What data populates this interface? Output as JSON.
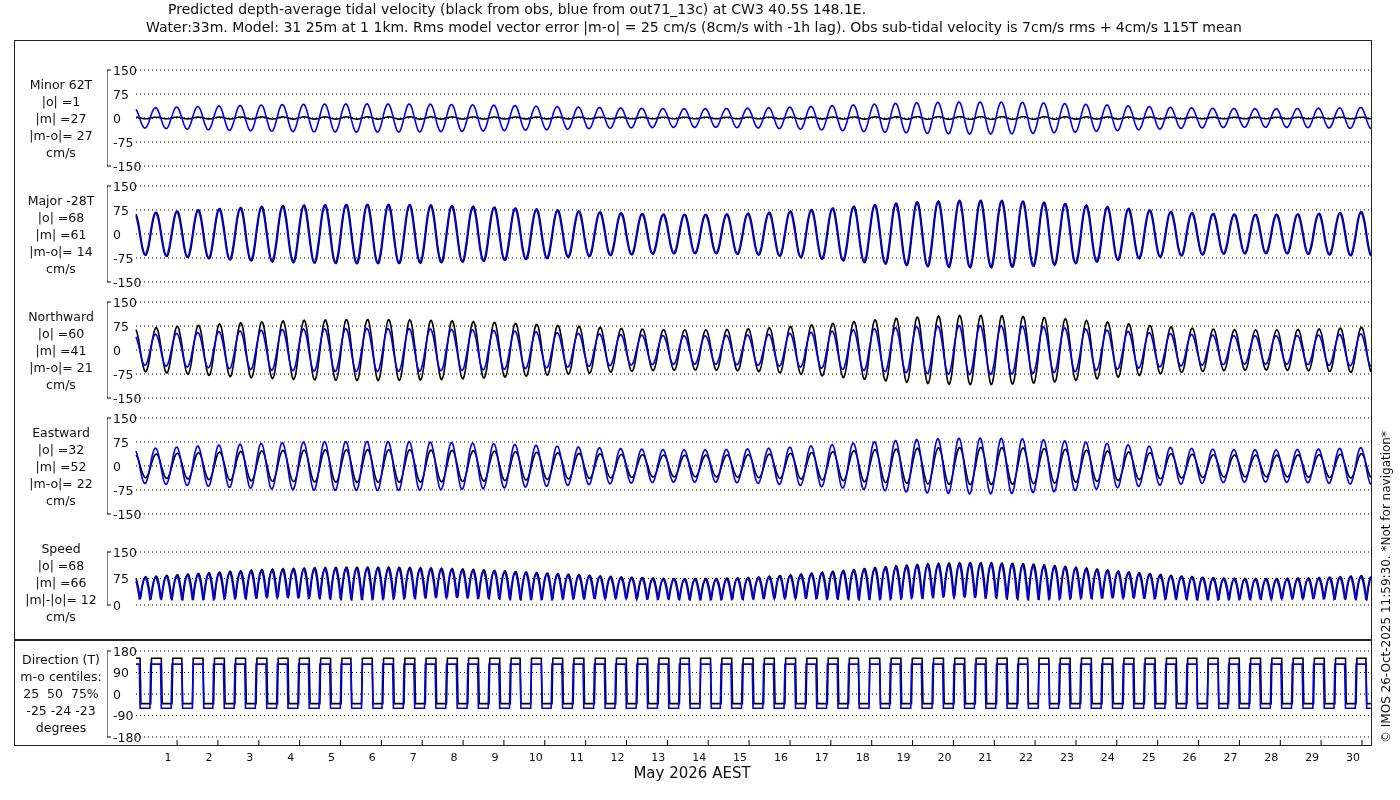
{
  "title": "Predicted depth-average tidal velocity (black from obs, blue from out71_13c) at CW3 40.5S 148.1E.",
  "subtitle": "Water:33m. Model: 31 25m at 1 1km. Rms model vector error |m-o| = 25 cm/s (8cm/s with -1h lag). Obs sub-tidal velocity is 7cm/s rms + 4cm/s 115T mean",
  "panels": [
    {
      "kind": "velocity",
      "label_lines": [
        "Minor 62T",
        "|o| =1",
        "|m| =27",
        "|m-o|= 27",
        "cm/s"
      ],
      "yticks": [
        "150",
        "75",
        "0",
        "-75",
        "-150"
      ]
    },
    {
      "kind": "velocity",
      "label_lines": [
        "Major -28T",
        "|o| =68",
        "|m| =61",
        "|m-o|= 14",
        "cm/s"
      ],
      "yticks": [
        "150",
        "75",
        "0",
        "-75",
        "-150"
      ]
    },
    {
      "kind": "velocity",
      "label_lines": [
        "Northward",
        "|o| =60",
        "|m| =41",
        "|m-o|= 21",
        "cm/s"
      ],
      "yticks": [
        "150",
        "75",
        "0",
        "-75",
        "-150"
      ]
    },
    {
      "kind": "velocity",
      "label_lines": [
        "Eastward",
        "|o| =32",
        "|m| =52",
        "|m-o|= 22",
        "cm/s"
      ],
      "yticks": [
        "150",
        "75",
        "0",
        "-75",
        "-150"
      ]
    },
    {
      "kind": "speed",
      "label_lines": [
        "Speed",
        "|o| =68",
        "|m| =66",
        "|m|-|o|= 12",
        "cm/s"
      ],
      "yticks": [
        "150",
        "75",
        "0"
      ]
    },
    {
      "kind": "direction",
      "label_lines": [
        "Direction (T)",
        "m-o centiles:",
        "25  50  75%",
        "-25 -24 -23",
        "degrees"
      ],
      "yticks": [
        "180",
        "90",
        "0",
        "-90",
        "-180"
      ]
    }
  ],
  "xaxis": {
    "ticks": [
      "1",
      "2",
      "3",
      "4",
      "5",
      "6",
      "7",
      "8",
      "9",
      "10",
      "11",
      "12",
      "13",
      "14",
      "15",
      "16",
      "17",
      "18",
      "19",
      "20",
      "21",
      "22",
      "23",
      "24",
      "25",
      "26",
      "27",
      "28",
      "29",
      "30"
    ],
    "label": "May 2026 AEST"
  },
  "credit": "© IMOS 26-Oct-2025 11:59:30. *Not for navigation*"
}
